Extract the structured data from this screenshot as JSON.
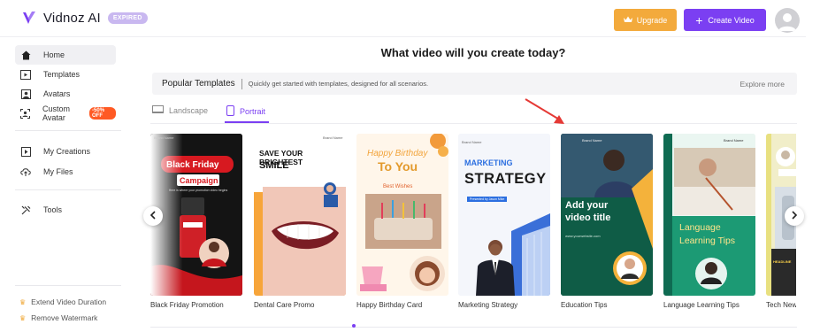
{
  "header": {
    "brand": "Vidnoz AI",
    "status_badge": "EXPIRED",
    "upgrade_label": "Upgrade",
    "create_label": "Create Video"
  },
  "sidebar": {
    "items": [
      {
        "label": "Home",
        "icon": "home-icon"
      },
      {
        "label": "Templates",
        "icon": "templates-icon"
      },
      {
        "label": "Avatars",
        "icon": "avatars-icon"
      },
      {
        "label": "Custom Avatar",
        "icon": "custom-avatar-icon",
        "badge": "-50% OFF"
      },
      {
        "label": "My Creations",
        "icon": "creations-icon"
      },
      {
        "label": "My Files",
        "icon": "files-icon"
      },
      {
        "label": "Tools",
        "icon": "tools-icon"
      }
    ],
    "bottom": [
      {
        "label": "Extend Video Duration"
      },
      {
        "label": "Remove Watermark"
      }
    ]
  },
  "main": {
    "title": "What video will you create today?",
    "popular": {
      "title": "Popular Templates",
      "subtitle": "Quickly get started with templates, designed for all scenarios.",
      "more": "Explore more"
    },
    "tabs": [
      {
        "label": "Landscape",
        "active": false
      },
      {
        "label": "Portrait",
        "active": true
      }
    ],
    "cards": [
      {
        "label": "Black Friday Promotion",
        "thumb": {
          "brand": "Brand Name",
          "line1": "Black Friday",
          "line2": "Campaign",
          "sub": "Here is where your promotion video begins"
        }
      },
      {
        "label": "Dental Care Promo",
        "thumb": {
          "brand": "Brand Name",
          "line1": "SAVE YOUR BRIGHTEST",
          "line2": "SMILE"
        }
      },
      {
        "label": "Happy Birthday Card",
        "thumb": {
          "line1": "Happy Birthday",
          "line2": "To You",
          "sub": "Best Wishes"
        }
      },
      {
        "label": "Marketing Strategy",
        "thumb": {
          "brand": "Brand Name",
          "line1": "MARKETING",
          "line2": "STRATEGY",
          "sub": "Presented by Jason Mike"
        }
      },
      {
        "label": "Education Tips",
        "thumb": {
          "brand": "Brand Name",
          "line1": "Add your",
          "line2": "video title",
          "sub": "www.yourwebsite.com"
        }
      },
      {
        "label": "Language Learning Tips",
        "thumb": {
          "brand": "Brand Name",
          "line1": "Language",
          "line2": "Learning Tips"
        }
      },
      {
        "label": "Tech New",
        "thumb": {
          "sub": "HEADLINE"
        }
      }
    ]
  },
  "colors": {
    "accent": "#7b3ff2",
    "upgrade": "#f3aa3c",
    "off_badge": "#ff5a24",
    "annotation_arrow": "#e53935"
  }
}
